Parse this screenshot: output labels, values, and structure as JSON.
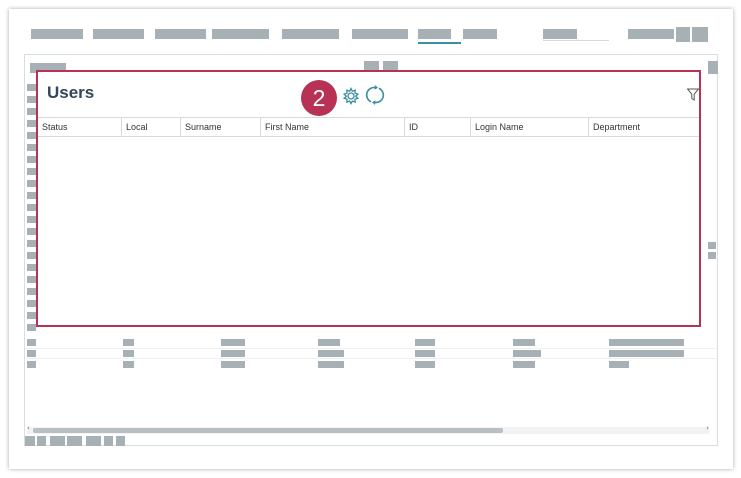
{
  "panel": {
    "title": "Users",
    "step_badge": "2",
    "toolbar_icons": [
      "settings-gear-icon",
      "refresh-icon"
    ],
    "filter_icon": "filter-icon"
  },
  "grid": {
    "columns": [
      "Status",
      "Local",
      "Surname",
      "First Name",
      "ID",
      "Login Name",
      "Department"
    ]
  },
  "colors": {
    "highlight": "#b83255",
    "title": "#33465a",
    "placeholder": "#a7b1b5",
    "icon_teal": "#3a8fa0"
  }
}
